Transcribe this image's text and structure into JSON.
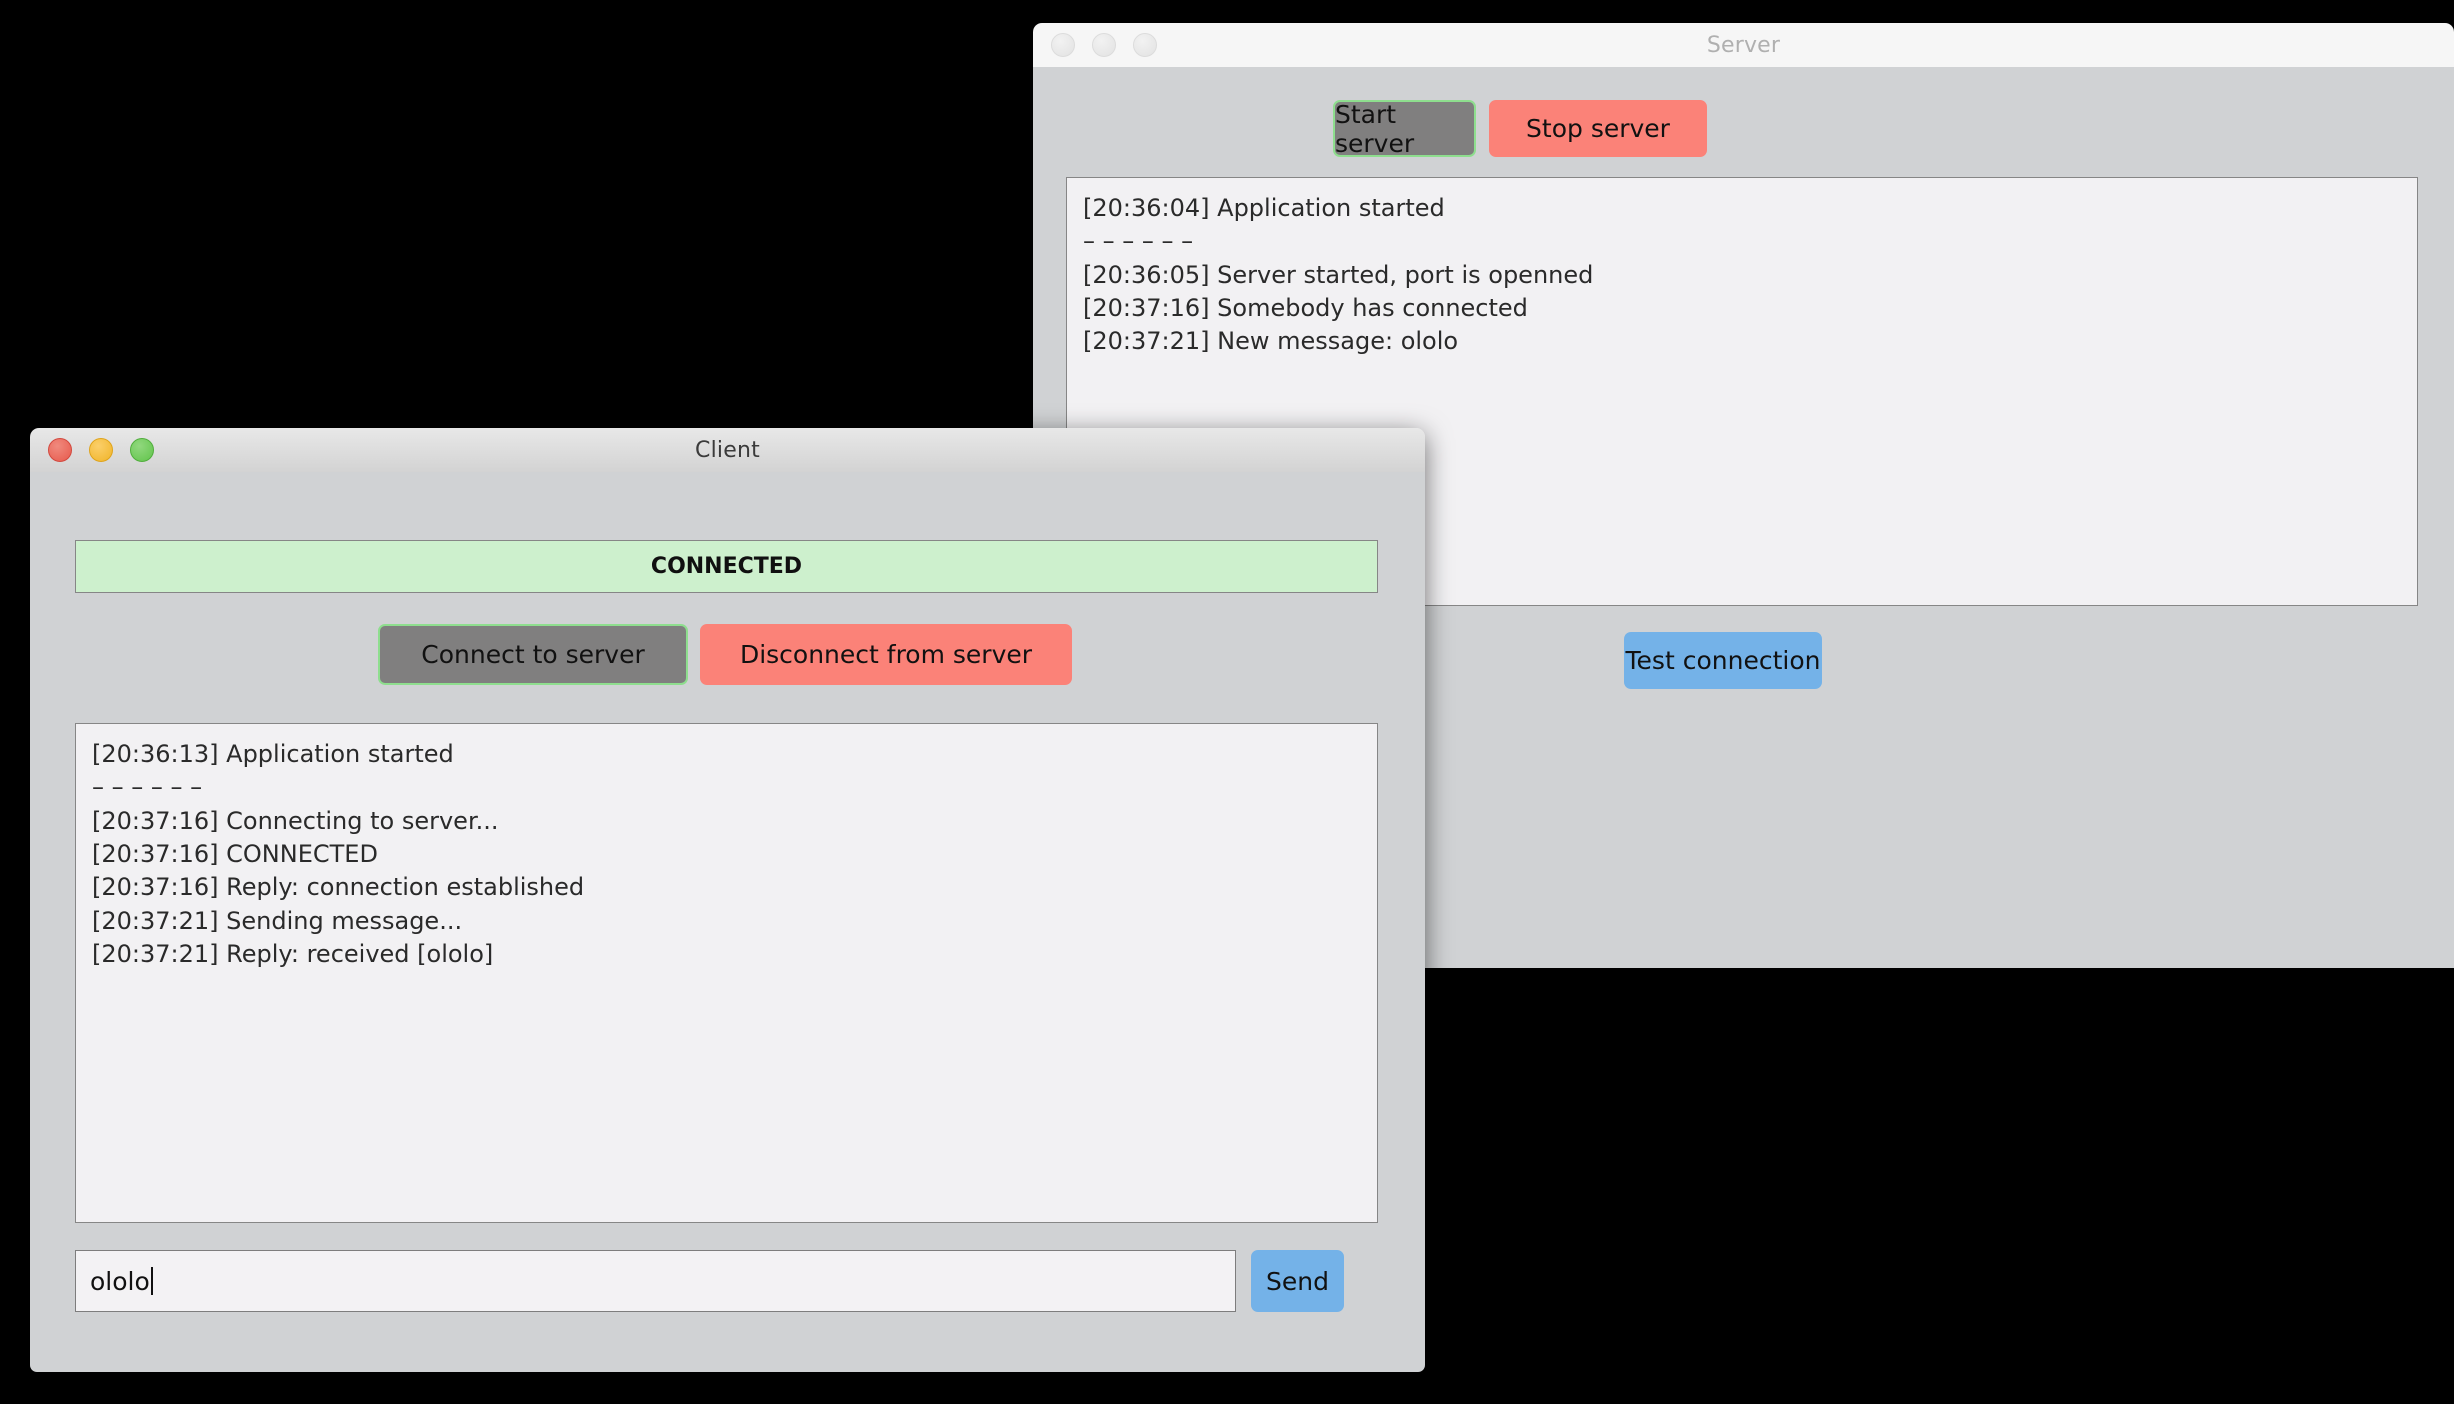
{
  "desktop": {
    "background": "#000000"
  },
  "server_window": {
    "title": "Server",
    "active": false,
    "traffic_lights": [
      "close",
      "minimize",
      "maximize"
    ],
    "buttons": {
      "start": "Start server",
      "stop": "Stop server",
      "test": "Test connection"
    },
    "log": [
      "[20:36:04] Application started",
      "– – – – – –",
      "[20:36:05] Server started, port is openned",
      "[20:37:16] Somebody has connected",
      "[20:37:21] New message: ololo"
    ]
  },
  "client_window": {
    "title": "Client",
    "active": true,
    "traffic_lights": [
      "close",
      "minimize",
      "maximize"
    ],
    "status": "CONNECTED",
    "buttons": {
      "connect": "Connect to server",
      "disconnect": "Disconnect from server",
      "send": "Send"
    },
    "log": [
      "[20:36:13] Application started",
      "– – – – – –",
      "[20:37:16] Connecting to server...",
      "[20:37:16] CONNECTED",
      "[20:37:16] Reply: connection established",
      "[20:37:21] Sending message...",
      "[20:37:21] Reply: received [ololo]"
    ],
    "message_input": {
      "value": "ololo",
      "placeholder": ""
    }
  },
  "colors": {
    "accent_blue": "#74b2e8",
    "danger_red": "#fb8278",
    "success_green_border": "#8ede8e",
    "banner_green": "#cdf0cd",
    "window_chrome": "#d0d2d4",
    "log_background": "#f2f1f3"
  }
}
